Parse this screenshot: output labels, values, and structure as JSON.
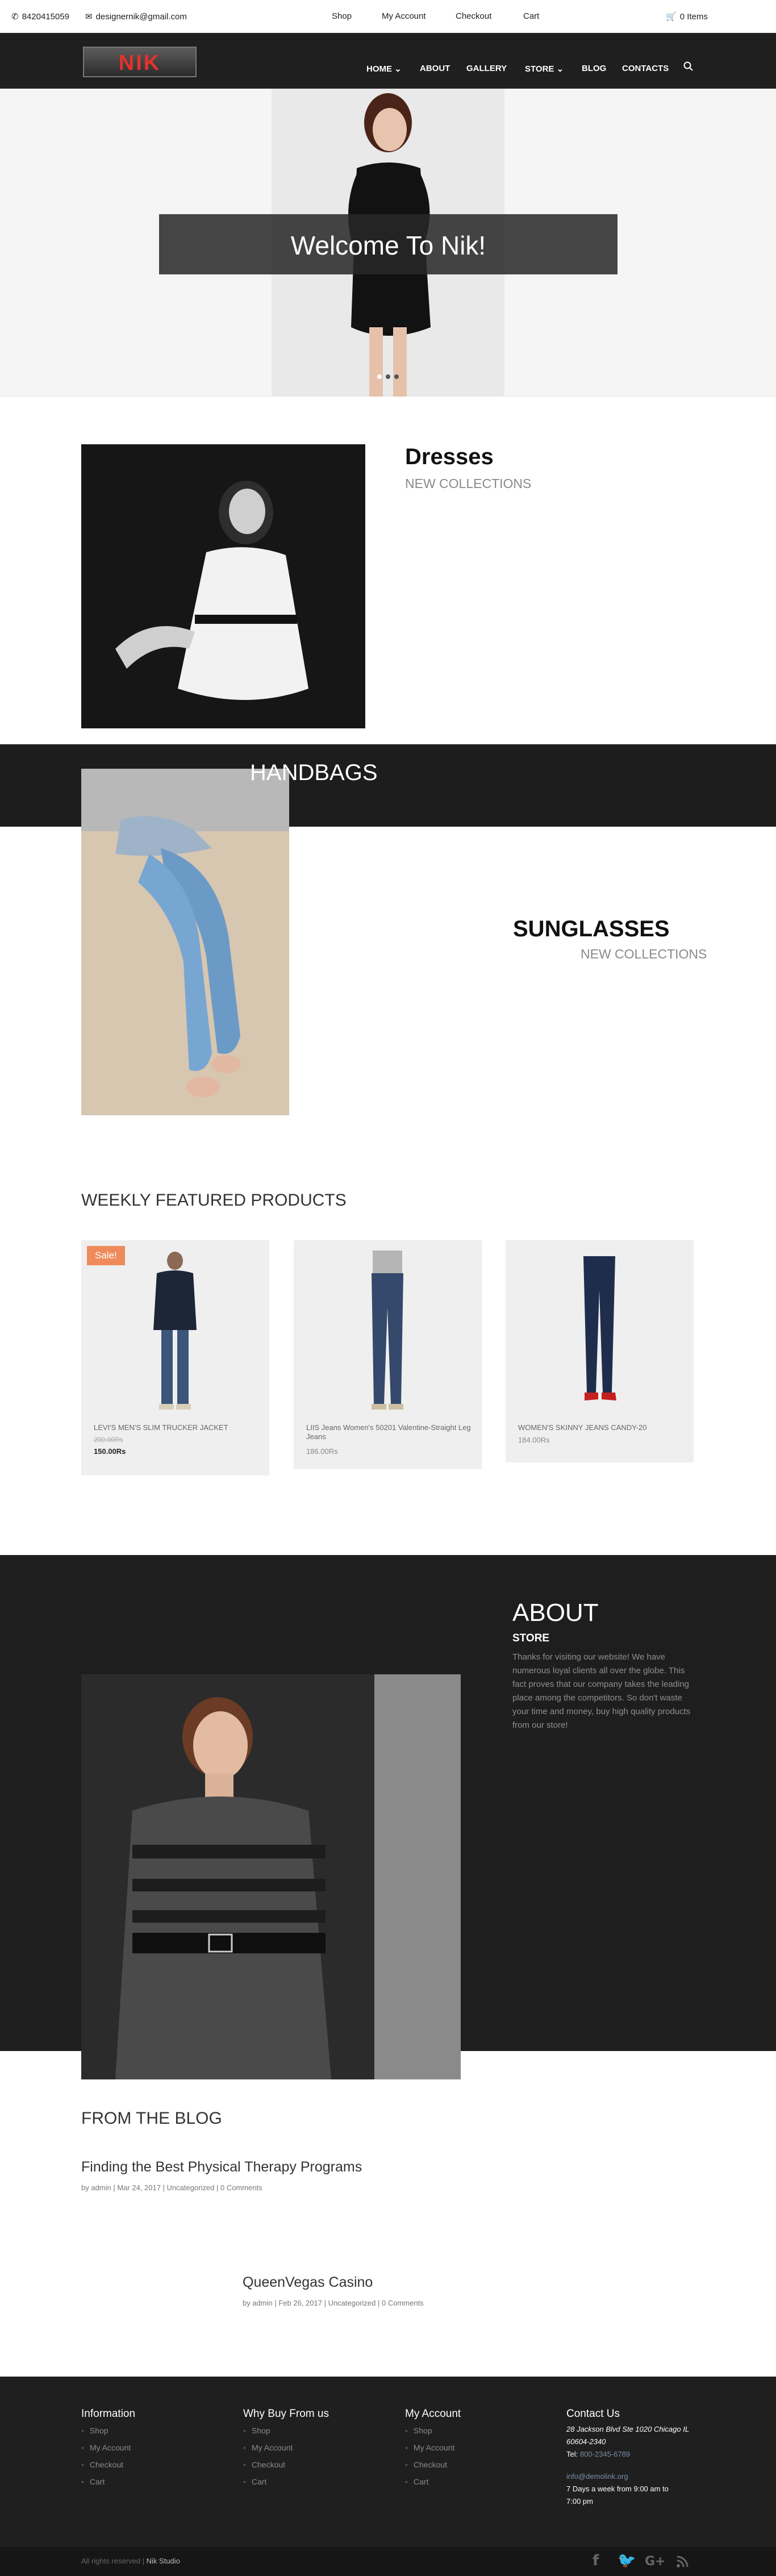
{
  "topbar": {
    "phone": "8420415059",
    "email": "designernik@gmail.com",
    "links": [
      "Shop",
      "My Account",
      "Checkout",
      "Cart"
    ],
    "cart": "0 Items"
  },
  "header": {
    "logo": "NIK",
    "nav": [
      "HOME",
      "ABOUT",
      "GALLERY",
      "STORE",
      "BLOG",
      "CONTACTS"
    ]
  },
  "hero": {
    "title": "Welcome To Nik!",
    "slide_count": 3,
    "active_slide": 1
  },
  "collections": [
    {
      "title": "Dresses",
      "subtitle": "NEW COLLECTIONS"
    },
    {
      "title": "HANDBAGS"
    },
    {
      "title": "SUNGLASSES",
      "subtitle": "NEW COLLECTIONS"
    }
  ],
  "featured": {
    "title": "WEEKLY FEATURED PRODUCTS",
    "products": [
      {
        "badge": "Sale!",
        "name": "LEVI'S MEN'S SLIM TRUCKER JACKET",
        "old_price": "200.00Rs",
        "price": "150.00Rs"
      },
      {
        "name": "LIIS Jeans Women's 50201 Valentine-Straight Leg Jeans",
        "price": "186.00Rs"
      },
      {
        "name": "WOMEN'S SKINNY JEANS CANDY-20",
        "price": "184.00Rs"
      }
    ]
  },
  "about": {
    "title": "ABOUT",
    "subtitle": "STORE",
    "text": "Thanks for visiting our website! We have numerous loyal clients all over the globe. This fact proves that our company takes the leading place among the competitors. So don't waste your time and money, buy high quality products from our store!"
  },
  "blog": {
    "title": "FROM THE BLOG",
    "posts": [
      {
        "title": "Finding the Best Physical Therapy Programs",
        "meta": "by admin | Mar 24, 2017 | Uncategorized | 0 Comments"
      },
      {
        "title": "QueenVegas Casino",
        "meta": "by admin | Feb 26, 2017 | Uncategorized | 0 Comments"
      }
    ]
  },
  "footer": {
    "columns": [
      {
        "title": "Information",
        "links": [
          "Shop",
          "My Account",
          "Checkout",
          "Cart"
        ]
      },
      {
        "title": "Why Buy From us",
        "links": [
          "Shop",
          "My Account",
          "Checkout",
          "Cart"
        ]
      },
      {
        "title": "My Account",
        "links": [
          "Shop",
          "My Account",
          "Checkout",
          "Cart"
        ]
      }
    ],
    "contact": {
      "title": "Contact Us",
      "address_1": "28 Jackson Blvd Ste 1020 Chicago IL",
      "address_2": "60604-2340",
      "tel_label": "Tel:",
      "tel": "800-2345-6789",
      "email": "info@demolink.org",
      "hours_1": "7 Days a week from 9:00 am to",
      "hours_2": "7:00 pm"
    },
    "copyright_text": "All rights reserved |",
    "copyright_brand": "Nik Studio",
    "social": [
      "facebook-icon",
      "twitter-icon",
      "google-plus-icon",
      "rss-icon"
    ]
  },
  "colors": {
    "dark": "#1f1f1f",
    "logo_red": "#e4322b",
    "sale": "#ef8b5a"
  }
}
